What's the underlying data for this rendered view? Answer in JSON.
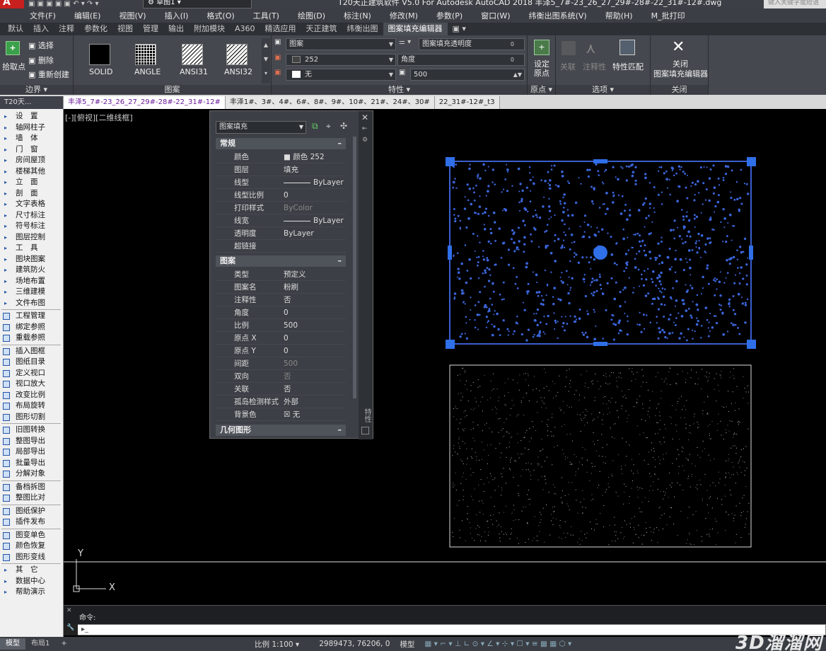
{
  "titlebar": {
    "workspace": "草图1",
    "title": "T20天正建筑软件 V5.0 For Autodesk AutoCAD 2018    丰泽5_7#-23_26_27_29#-28#-22_31#-12#.dwg",
    "search_placeholder": "键入关键字或短语"
  },
  "menubar": [
    "文件(F)",
    "编辑(E)",
    "视图(V)",
    "插入(I)",
    "格式(O)",
    "工具(T)",
    "绘图(D)",
    "标注(N)",
    "修改(M)",
    "参数(P)",
    "窗口(W)",
    "纬衡出图系统(V)",
    "帮助(H)",
    "M_批打印"
  ],
  "ribbon_tabs": [
    "默认",
    "插入",
    "注释",
    "参数化",
    "视图",
    "管理",
    "输出",
    "附加模块",
    "A360",
    "精选应用",
    "天正建筑",
    "纬衡出图",
    "图案填充编辑器",
    "▣ ▾"
  ],
  "ribbon": {
    "boundary": {
      "pick": "拾取点",
      "select": "选择",
      "remove": "删除",
      "recreate": "重新创建",
      "label": "边界 ▾"
    },
    "pattern": {
      "items": [
        "SOLID",
        "ANGLE",
        "ANSI31",
        "ANSI32"
      ],
      "label": "图案"
    },
    "properties": {
      "type": "图案",
      "color": "252",
      "bgcolor": "无",
      "transparency_label": "图案填充透明度",
      "transparency_value": "0",
      "angle_label": "角度",
      "angle_value": "0",
      "scale_value": "500",
      "label": "特性 ▾"
    },
    "origin": {
      "set": "设定原点",
      "label": "原点 ▾"
    },
    "options": {
      "assoc": "关联",
      "annot": "注释性",
      "match": "特性匹配",
      "label": "选项 ▾"
    },
    "close": {
      "btn": "关闭图案填充编辑器",
      "line1": "关闭",
      "line2": "图案填充编辑器",
      "label": "关闭"
    }
  },
  "doc_tabs": [
    "T20天...",
    "丰泽5_7#-23_26_27_29#-28#-22_31#-12#",
    "丰泽1#、3#、4#、6#、8#、9#、10#、21#、24#、30#",
    "22_31#-12#_t3"
  ],
  "left_panel": {
    "tree": [
      "设　置",
      "轴网柱子",
      "墙　体",
      "门　窗",
      "房间屋顶",
      "楼梯其他",
      "立　面",
      "剖　面",
      "文字表格",
      "尺寸标注",
      "符号标注",
      "图层控制",
      "工　具",
      "图块图案",
      "建筑防火",
      "场地布置",
      "三维建模",
      "文件布图"
    ],
    "group1": [
      "工程管理",
      "绑定参照",
      "重载参照"
    ],
    "group2": [
      "插入图框",
      "图纸目录",
      "定义视口",
      "视口放大",
      "改变比例",
      "布局旋转",
      "图形切割"
    ],
    "group3": [
      "旧图转换",
      "整图导出",
      "局部导出",
      "批量导出",
      "分解对象"
    ],
    "group4": [
      "备档拆图",
      "整图比对"
    ],
    "group5": [
      "图纸保护",
      "插件发布"
    ],
    "group6": [
      "图变单色",
      "颜色恢复",
      "图形变线"
    ],
    "tree2": [
      "其　它",
      "数据中心",
      "帮助演示"
    ]
  },
  "viewport_label": "[-][俯视][二维线框]",
  "properties": {
    "selector": "图案填充",
    "sections": {
      "general": {
        "title": "常规",
        "rows": [
          {
            "k": "颜色",
            "v": "■ 颜色 252"
          },
          {
            "k": "图层",
            "v": "填充"
          },
          {
            "k": "线型",
            "v": "ByLayer"
          },
          {
            "k": "线型比例",
            "v": "0"
          },
          {
            "k": "打印样式",
            "v": "ByColor"
          },
          {
            "k": "线宽",
            "v": "ByLayer"
          },
          {
            "k": "透明度",
            "v": "ByLayer"
          },
          {
            "k": "超链接",
            "v": ""
          }
        ]
      },
      "pattern": {
        "title": "图案",
        "rows": [
          {
            "k": "类型",
            "v": "预定义"
          },
          {
            "k": "图案名",
            "v": "粉刷"
          },
          {
            "k": "注释性",
            "v": "否"
          },
          {
            "k": "角度",
            "v": "0"
          },
          {
            "k": "比例",
            "v": "500"
          },
          {
            "k": "原点 X",
            "v": "0"
          },
          {
            "k": "原点 Y",
            "v": "0"
          },
          {
            "k": "间距",
            "v": "500"
          },
          {
            "k": "双向",
            "v": "否"
          },
          {
            "k": "关联",
            "v": "否"
          },
          {
            "k": "孤岛检测样式",
            "v": "外部"
          },
          {
            "k": "背景色",
            "v": "☒ 无"
          }
        ]
      },
      "geometry": {
        "title": "几何图形"
      }
    },
    "side_label": "特性"
  },
  "ucs": {
    "y": "Y",
    "x": "X"
  },
  "command": {
    "label": "命令:",
    "input": ""
  },
  "layout_tabs": [
    "模型",
    "布局1",
    "+"
  ],
  "status": {
    "scale": "比例 1:100 ▾",
    "coords": "2989473, 76206, 0",
    "model": "模型"
  },
  "watermark": "3D溜溜网",
  "colors": {
    "selection_blue": "#2f5fcf",
    "hatch_dots": "#3a64d8"
  }
}
